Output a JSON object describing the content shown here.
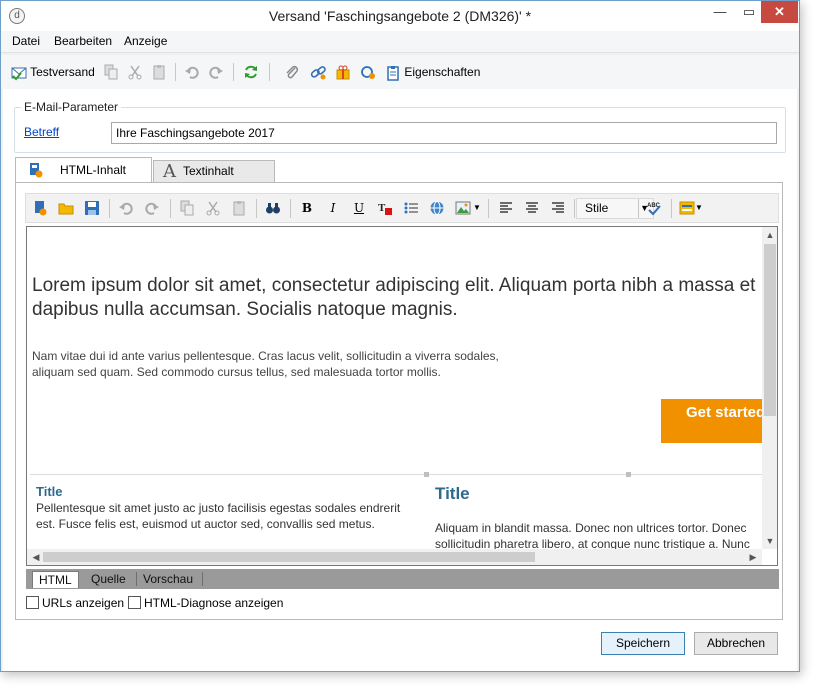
{
  "window": {
    "title": "Versand 'Faschingsangebote 2 (DM326)' *",
    "min_glyph": "—",
    "max_glyph": "▭",
    "close_glyph": "✕",
    "app_glyph": "d"
  },
  "menubar": {
    "items": [
      "Datei",
      "Bearbeiten",
      "Anzeige"
    ]
  },
  "toolbar": {
    "test_send": "Testversand",
    "properties": "Eigenschaften"
  },
  "email_params": {
    "legend": "E-Mail-Parameter",
    "subject_label": "Betreff",
    "subject_value": "Ihre Faschingsangebote 2017"
  },
  "tabs": {
    "html": "HTML-Inhalt",
    "text": "Textinhalt",
    "text_glyph": "A"
  },
  "editor_toolbar": {
    "style_label": "Stile",
    "bold": "B",
    "italic": "I",
    "underline": "U"
  },
  "content": {
    "heading": "Lorem ipsum dolor sit amet, consectetur adipiscing elit. Aliquam porta nibh a massa et dapibus nulla accumsan. Socialis natoque magnis.",
    "paragraph": "Nam vitae dui id ante varius pellentesque. Cras lacus velit, sollicitudin a viverra sodales, aliquam sed quam. Sed commodo cursus tellus, sed malesuada tortor mollis.",
    "cta_label": "Get started",
    "left_title": "Title",
    "left_text": "Pellentesque sit amet justo ac justo facilisis egestas sodales endrerit est. Fusce felis est, euismod ut auctor sed, convallis sed metus.",
    "right_title": "Title",
    "right_text_1": "Aliquam in blandit massa. Donec non ultrices tortor. Donec",
    "right_text_2": "sollicitudin pharetra libero, at congue nunc tristique a. Nunc"
  },
  "view_tabs": [
    "HTML",
    "Quelle",
    "Vorschau"
  ],
  "options": {
    "show_urls": "URLs anzeigen",
    "html_diag": "HTML-Diagnose anzeigen"
  },
  "buttons": {
    "save": "Speichern",
    "cancel": "Abbrechen"
  },
  "colors": {
    "accent": "#f29100",
    "title_blue": "#2d6a8c",
    "link": "#0044cc",
    "close": "#c74a41"
  }
}
